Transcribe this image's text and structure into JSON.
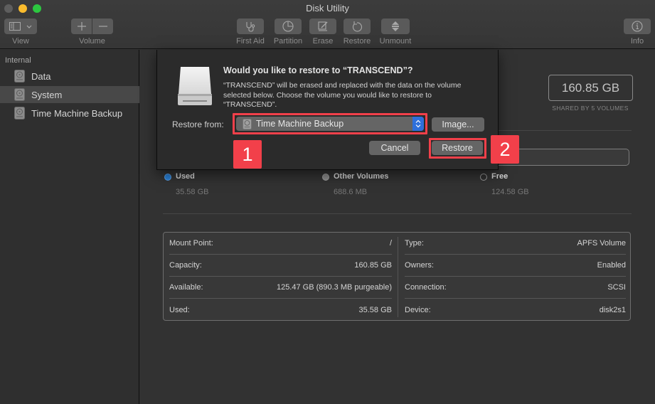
{
  "window": {
    "title": "Disk Utility"
  },
  "toolbar": {
    "view_label": "View",
    "volume_label": "Volume",
    "first_aid_label": "First Aid",
    "partition_label": "Partition",
    "erase_label": "Erase",
    "restore_label": "Restore",
    "unmount_label": "Unmount",
    "info_label": "Info"
  },
  "sidebar": {
    "section": "Internal",
    "items": [
      {
        "label": "Data",
        "selected": false
      },
      {
        "label": "System",
        "selected": true
      },
      {
        "label": "Time Machine Backup",
        "selected": false
      }
    ]
  },
  "main": {
    "capacity": "160.85 GB",
    "capacity_sub": "SHARED BY 5 VOLUMES",
    "legend": [
      {
        "name": "Used",
        "value": "35.58 GB",
        "color": "#2a7fd4"
      },
      {
        "name": "Other Volumes",
        "value": "688.6 MB",
        "color": "#8a8a8a"
      },
      {
        "name": "Free",
        "value": "124.58 GB",
        "color": "#2f2f2f"
      }
    ],
    "info_left": [
      {
        "label": "Mount Point:",
        "value": "/"
      },
      {
        "label": "Capacity:",
        "value": "160.85 GB"
      },
      {
        "label": "Available:",
        "value": "125.47 GB (890.3 MB purgeable)"
      },
      {
        "label": "Used:",
        "value": "35.58 GB"
      }
    ],
    "info_right": [
      {
        "label": "Type:",
        "value": "APFS Volume"
      },
      {
        "label": "Owners:",
        "value": "Enabled"
      },
      {
        "label": "Connection:",
        "value": "SCSI"
      },
      {
        "label": "Device:",
        "value": "disk2s1"
      }
    ]
  },
  "dialog": {
    "title": "Would you like to restore to “TRANSCEND”?",
    "message": "“TRANSCEND” will be erased and replaced with the data on the volume selected below. Choose the volume you would like to restore to “TRANSCEND”.",
    "restore_from_label": "Restore from:",
    "restore_from_value": "Time Machine Backup",
    "image_button": "Image...",
    "cancel_button": "Cancel",
    "restore_button": "Restore"
  },
  "annotations": {
    "badge_1": "1",
    "badge_2": "2",
    "highlight_color": "#f2404a"
  }
}
